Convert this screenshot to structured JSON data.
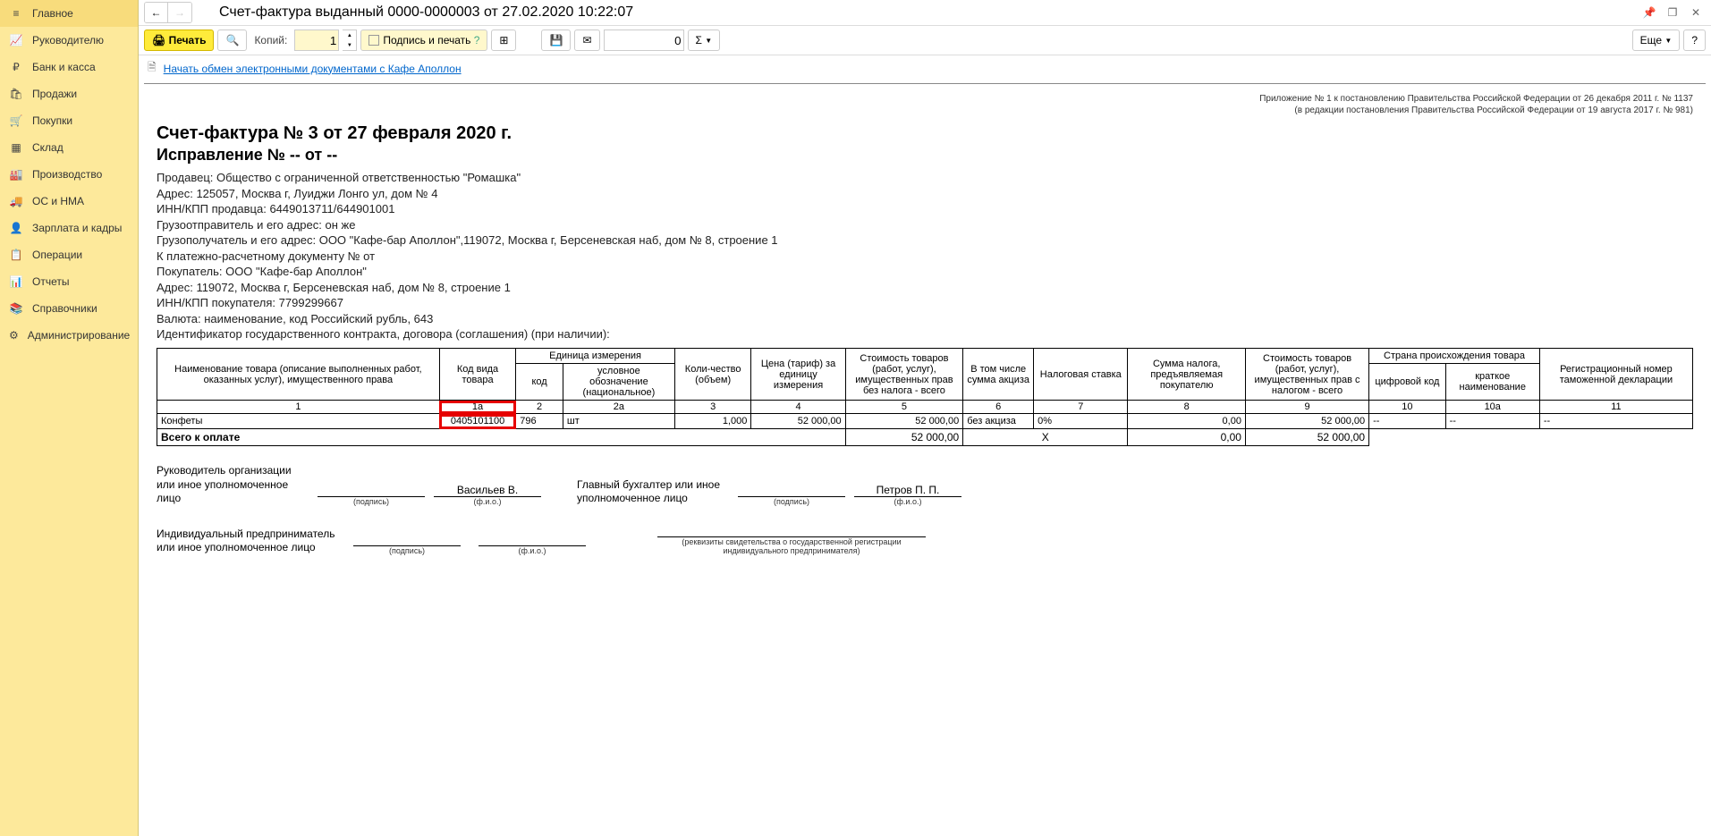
{
  "sidebar": {
    "items": [
      {
        "label": "Главное"
      },
      {
        "label": "Руководителю"
      },
      {
        "label": "Банк и касса"
      },
      {
        "label": "Продажи"
      },
      {
        "label": "Покупки"
      },
      {
        "label": "Склад"
      },
      {
        "label": "Производство"
      },
      {
        "label": "ОС и НМА"
      },
      {
        "label": "Зарплата и кадры"
      },
      {
        "label": "Операции"
      },
      {
        "label": "Отчеты"
      },
      {
        "label": "Справочники"
      },
      {
        "label": "Администрирование"
      }
    ]
  },
  "header": {
    "title": "Счет-фактура выданный 0000-0000003 от 27.02.2020 10:22:07"
  },
  "toolbar": {
    "print": "Печать",
    "copies_label": "Копий:",
    "copies_value": "1",
    "sign_print": "Подпись и печать",
    "sum_value": "0",
    "more": "Еще"
  },
  "link": {
    "start_exchange": "Начать обмен электронными документами с Кафе Аполлон"
  },
  "doc": {
    "annotation1": "Приложение № 1 к постановлению Правительства Российской Федерации от 26 декабря 2011 г. № 1137",
    "annotation2": "(в редакции постановления Правительства Российской Федерации от 19 августа 2017 г. № 981)",
    "title": "Счет-фактура № 3 от 27 февраля 2020 г.",
    "subtitle": "Исправление № -- от --",
    "lines": {
      "seller": "Продавец: Общество с ограниченной ответственностью \"Ромашка\"",
      "addr": "Адрес: 125057, Москва г, Луиджи Лонго ул, дом № 4",
      "inn": "ИНН/КПП продавца: 6449013711/644901001",
      "shipper": "Грузоотправитель и его адрес: он же",
      "consignee": "Грузополучатель и его адрес: ООО \"Кафе-бар Аполлон\",119072, Москва г, Берсеневская наб, дом № 8, строение 1",
      "payment": "К платежно-расчетному документу №   от",
      "buyer": "Покупатель: ООО \"Кафе-бар Аполлон\"",
      "buyer_addr": "Адрес: 119072, Москва г, Берсеневская наб, дом № 8, строение 1",
      "buyer_inn": "ИНН/КПП покупателя: 7799299667",
      "currency": "Валюта: наименование, код Российский рубль, 643",
      "contract": "Идентификатор государственного контракта, договора (соглашения) (при наличии):"
    },
    "headers": {
      "name": "Наименование товара (описание выполненных работ, оказанных услуг), имущественного права",
      "code": "Код вида товара",
      "unit": "Единица измерения",
      "unit_code": "код",
      "unit_name": "условное обозначение (национальное)",
      "qty": "Коли-чество (объем)",
      "price": "Цена (тариф) за единицу измерения",
      "cost_novat": "Стоимость товаров (работ, услуг), имущественных прав без налога - всего",
      "excise": "В том числе сумма акциза",
      "rate": "Налоговая ставка",
      "vat": "Сумма налога, предъявляемая покупателю",
      "cost_vat": "Стоимость товаров (работ, услуг), имущественных прав с налогом - всего",
      "country": "Страна происхождения товара",
      "country_code": "цифровой код",
      "country_name": "краткое наименование",
      "customs": "Регистрационный номер таможенной декларации"
    },
    "colnums": {
      "c1": "1",
      "c1a": "1а",
      "c2": "2",
      "c2a": "2а",
      "c3": "3",
      "c4": "4",
      "c5": "5",
      "c6": "6",
      "c7": "7",
      "c8": "8",
      "c9": "9",
      "c10": "10",
      "c10a": "10а",
      "c11": "11"
    },
    "row": {
      "name": "Конфеты",
      "code": "0405101100",
      "unit_code": "796",
      "unit_name": "шт",
      "qty": "1,000",
      "price": "52 000,00",
      "cost_novat": "52 000,00",
      "excise": "без акциза",
      "rate": "0%",
      "vat": "0,00",
      "cost_vat": "52 000,00",
      "country_code": "--",
      "country_name": "--",
      "customs": "--"
    },
    "total": {
      "label": "Всего к оплате",
      "cost_novat": "52 000,00",
      "x": "X",
      "vat": "0,00",
      "cost_vat": "52 000,00"
    },
    "sig": {
      "head_label": "Руководитель организации или иное уполномоченное лицо",
      "acc_label": "Главный бухгалтер или иное уполномоченное лицо",
      "ip_label": "Индивидуальный предприниматель или иное уполномоченное лицо",
      "head_name": "Васильев В.",
      "acc_name": "Петров П. П.",
      "podpis": "(подпись)",
      "fio": "(ф.и.о.)",
      "recv": "(реквизиты свидетельства о государственной регистрации индивидуального предпринимателя)"
    }
  }
}
